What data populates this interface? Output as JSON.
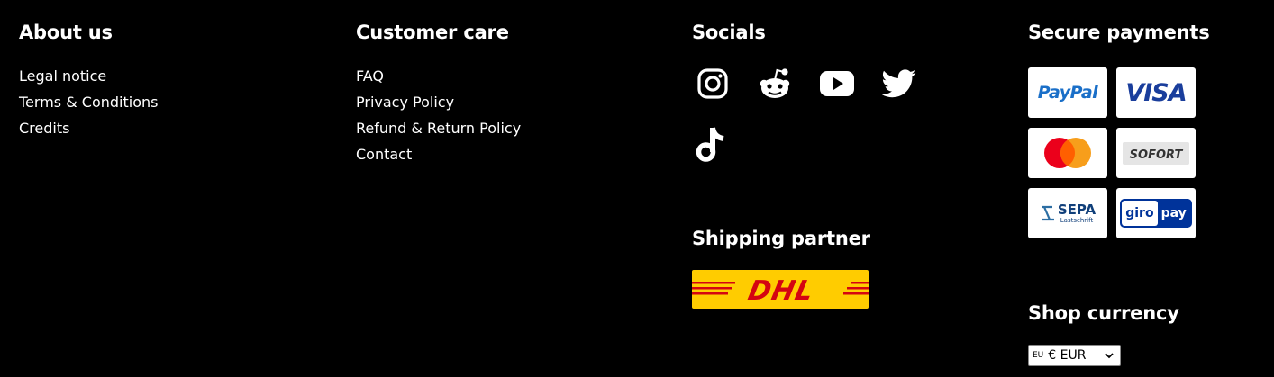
{
  "about": {
    "title": "About us",
    "links": [
      "Legal notice",
      "Terms & Conditions",
      "Credits"
    ]
  },
  "care": {
    "title": "Customer care",
    "links": [
      "FAQ",
      "Privacy Policy",
      "Refund & Return Policy",
      "Contact"
    ]
  },
  "socials": {
    "title": "Socials",
    "icons": [
      "instagram-icon",
      "reddit-icon",
      "youtube-icon",
      "twitter-icon",
      "tiktok-icon"
    ]
  },
  "shipping": {
    "title": "Shipping partner",
    "partner_logo_text": "DHL",
    "logo_colors": {
      "background": "#ffcc00",
      "foreground": "#d40511"
    }
  },
  "payments": {
    "title": "Secure payments",
    "methods": [
      {
        "name": "PayPal",
        "logo_text": "PayPal"
      },
      {
        "name": "Visa",
        "logo_text": "VISA"
      },
      {
        "name": "Mastercard",
        "logo_text": ""
      },
      {
        "name": "Sofort",
        "logo_text": "SOFORT"
      },
      {
        "name": "SEPA Lastschrift",
        "logo_text": "SEPA",
        "logo_subtext": "Lastschrift"
      },
      {
        "name": "giropay",
        "logo_text": "giro",
        "logo_text_2": "pay"
      }
    ]
  },
  "currency": {
    "title": "Shop currency",
    "selected_flag": "EU",
    "selected_value": "€ EUR"
  },
  "colors": {
    "background": "#000000",
    "text": "#ffffff"
  }
}
